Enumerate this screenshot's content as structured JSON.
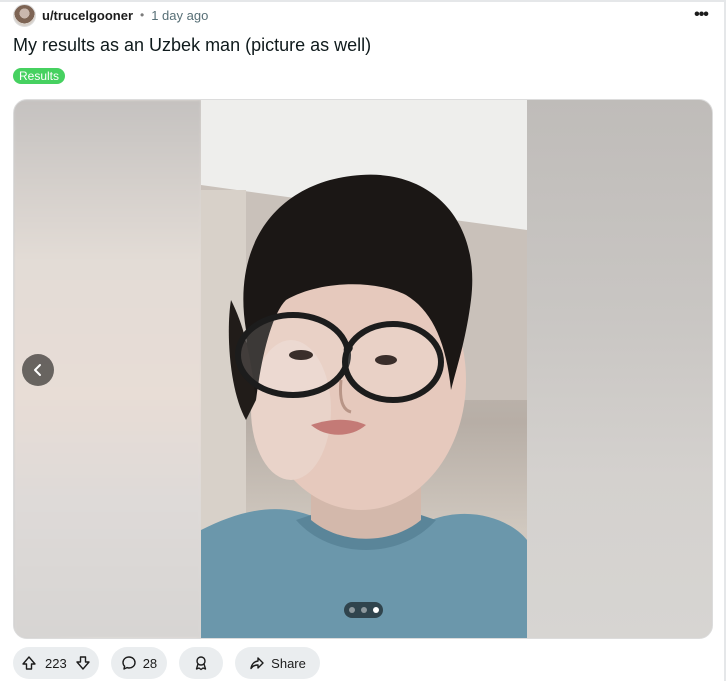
{
  "post": {
    "username": "u/trucelgooner",
    "separator": "•",
    "time": "1 day ago",
    "more_label": "•••",
    "title": "My results as an Uzbek man (picture as well)",
    "flair": "Results",
    "flair_color": "#46d160"
  },
  "gallery": {
    "image_alt": "Selfie of a young man with black hair and round glasses wearing a light blue t-shirt",
    "pages_total": 3,
    "current_page": 3,
    "prev_icon": "chevron-left-icon"
  },
  "actions": {
    "upvote_icon": "upvote-icon",
    "score": "223",
    "downvote_icon": "downvote-icon",
    "comment_icon": "comment-icon",
    "comments": "28",
    "award_icon": "award-icon",
    "share_icon": "share-icon",
    "share_label": "Share"
  }
}
